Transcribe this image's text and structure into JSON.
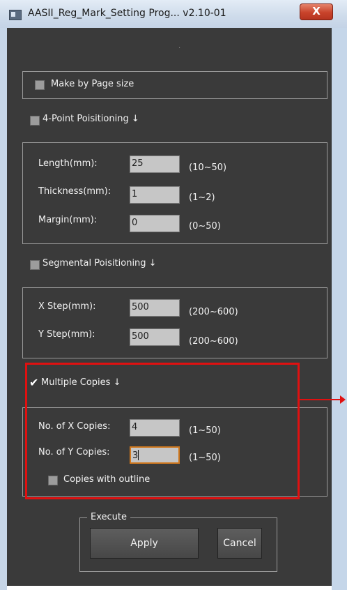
{
  "window": {
    "title": "AASII_Reg_Mark_Setting Prog... v2.10-01",
    "close_symbol": "X"
  },
  "dot": "·",
  "make_by_page": {
    "label": "Make by Page size",
    "checked": false
  },
  "four_point": {
    "label": "4-Point Poisitioning ↓",
    "checked": false,
    "fields": [
      {
        "label": "Length(mm):",
        "value": "25",
        "range": "(10~50)"
      },
      {
        "label": "Thickness(mm):",
        "value": "1",
        "range": "(1~2)"
      },
      {
        "label": "Margin(mm):",
        "value": "0",
        "range": "(0~50)"
      }
    ]
  },
  "segmental": {
    "label": "Segmental Poisitioning ↓",
    "checked": false,
    "fields": [
      {
        "label": "X Step(mm):",
        "value": "500",
        "range": "(200~600)"
      },
      {
        "label": "Y Step(mm):",
        "value": "500",
        "range": "(200~600)"
      }
    ]
  },
  "multiple": {
    "label": "Multiple Copies ↓",
    "checked": true,
    "check_symbol": "✔",
    "fields": [
      {
        "label": "No. of X Copies:",
        "value": "4",
        "range": "(1~50)"
      },
      {
        "label": "No. of Y Copies:",
        "value": "3",
        "range": "(1~50)"
      }
    ],
    "outline_label": "Copies with outline"
  },
  "execute": {
    "legend": "Execute",
    "apply_label": "Apply",
    "cancel_label": "Cancel"
  },
  "colors": {
    "client_bg": "#3a3a3a",
    "highlight": "#e01010",
    "focus": "#d0781e"
  }
}
